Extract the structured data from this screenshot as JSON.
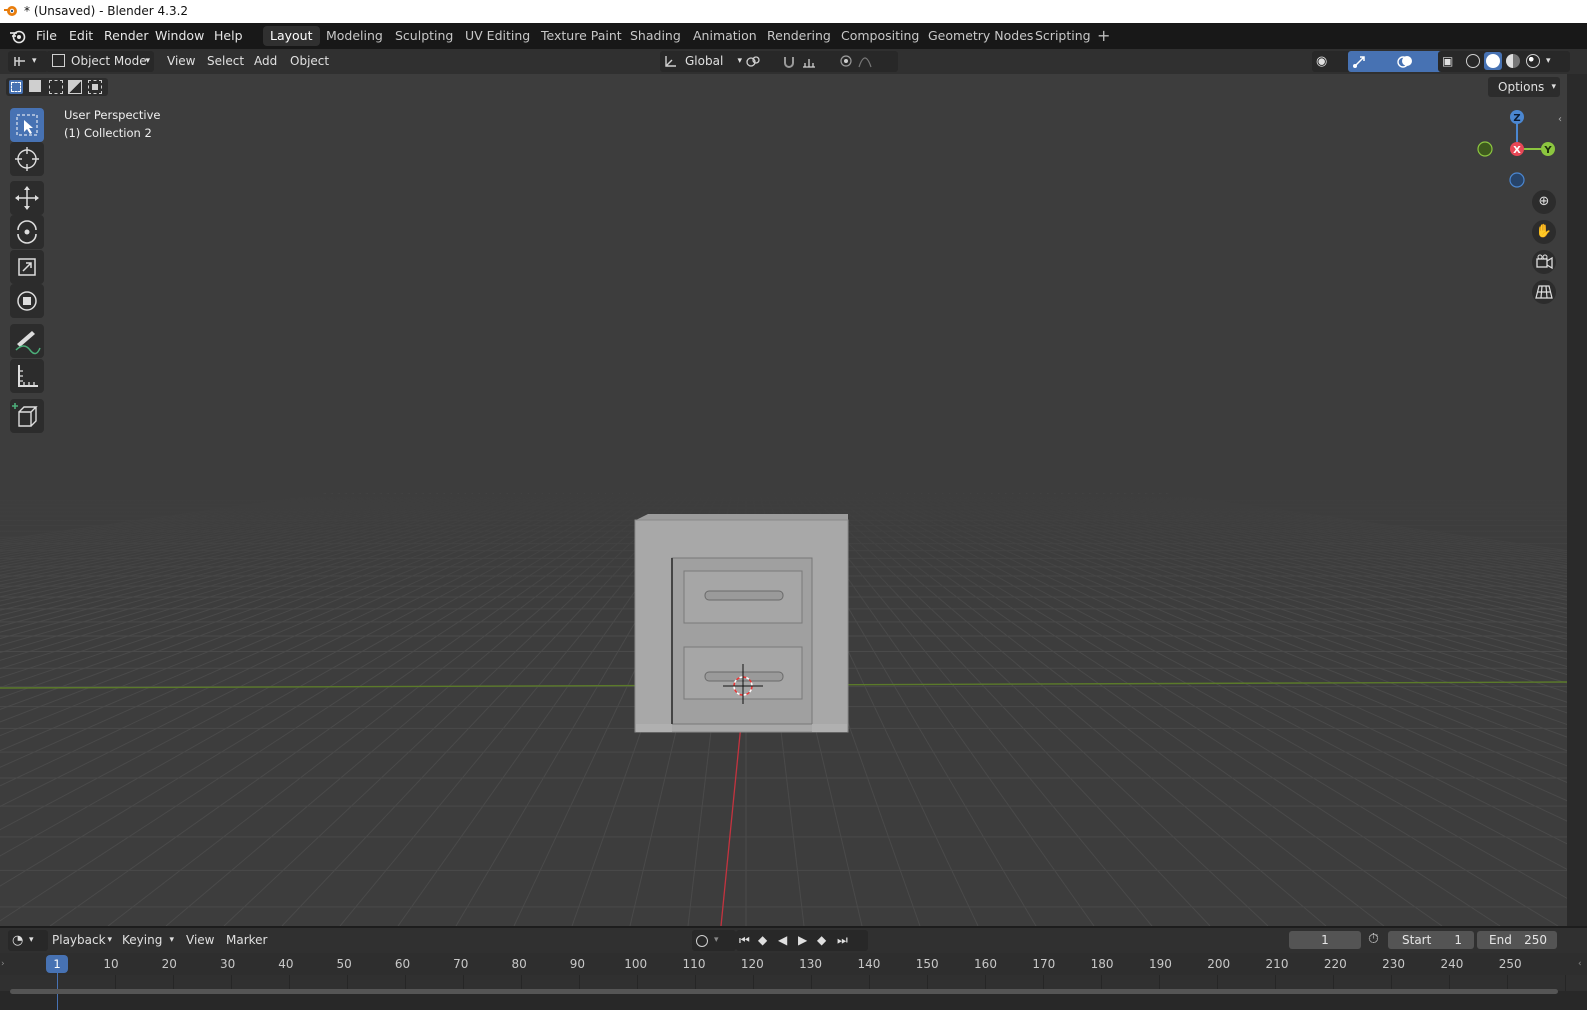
{
  "window": {
    "title": "* (Unsaved) - Blender 4.3.2"
  },
  "menu": [
    "File",
    "Edit",
    "Render",
    "Window",
    "Help"
  ],
  "workspace_tabs": [
    "Layout",
    "Modeling",
    "Sculpting",
    "UV Editing",
    "Texture Paint",
    "Shading",
    "Animation",
    "Rendering",
    "Compositing",
    "Geometry Nodes",
    "Scripting"
  ],
  "active_workspace": "Layout",
  "viewport_header": {
    "mode": "Object Mode",
    "menus": [
      "View",
      "Select",
      "Add",
      "Object"
    ],
    "transform_orientation": "Global",
    "options_label": "Options"
  },
  "viewport": {
    "view_name": "User Perspective",
    "collection": "(1) Collection 2"
  },
  "gizmo": {
    "z": "Z",
    "x": "X",
    "y": "Y"
  },
  "timeline": {
    "menus": [
      "Playback",
      "Keying",
      "View",
      "Marker"
    ],
    "current_frame": "1",
    "start_label": "Start",
    "start_value": "1",
    "end_label": "End",
    "end_value": "250",
    "playhead_label": "1",
    "ticks": [
      "10",
      "20",
      "30",
      "40",
      "50",
      "60",
      "70",
      "80",
      "90",
      "100",
      "110",
      "120",
      "130",
      "140",
      "150",
      "160",
      "170",
      "180",
      "190",
      "200",
      "210",
      "220",
      "230",
      "240",
      "250"
    ]
  },
  "colors": {
    "accent": "#4772b3",
    "x_axis": "#e84756",
    "y_axis": "#8cc63f",
    "z_axis": "#4b87d1"
  }
}
